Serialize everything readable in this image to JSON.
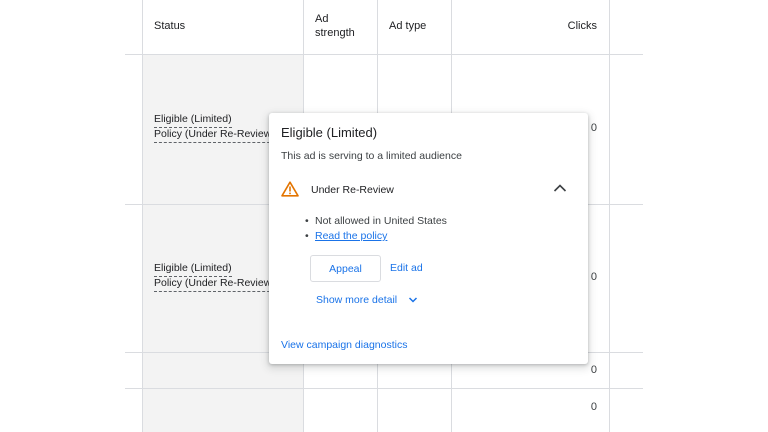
{
  "table": {
    "headers": {
      "status": "Status",
      "ad_strength_line1": "Ad",
      "ad_strength_line2": "strength",
      "ad_type": "Ad type",
      "clicks": "Clicks"
    },
    "rows": [
      {
        "status_line1": "Eligible (Limited)",
        "status_line2": "Policy (Under Re-Review)",
        "clicks": "0"
      },
      {
        "status_line1": "Eligible (Limited)",
        "status_line2": "Policy (Under Re-Review)",
        "clicks": "0"
      },
      {
        "clicks": "0"
      },
      {
        "clicks": "0"
      }
    ]
  },
  "popup": {
    "title": "Eligible (Limited)",
    "subtitle": "This ad is serving to a limited audience",
    "section_icon": "warning-triangle-icon",
    "section_label": "Under Re-Review",
    "details": [
      "Not allowed in United States",
      "Read the policy"
    ],
    "appeal_label": "Appeal",
    "edit_label": "Edit ad",
    "show_more_label": "Show more detail",
    "diagnostics_label": "View campaign diagnostics",
    "colors": {
      "accent": "#1a73e8",
      "warning": "#e37400"
    }
  }
}
